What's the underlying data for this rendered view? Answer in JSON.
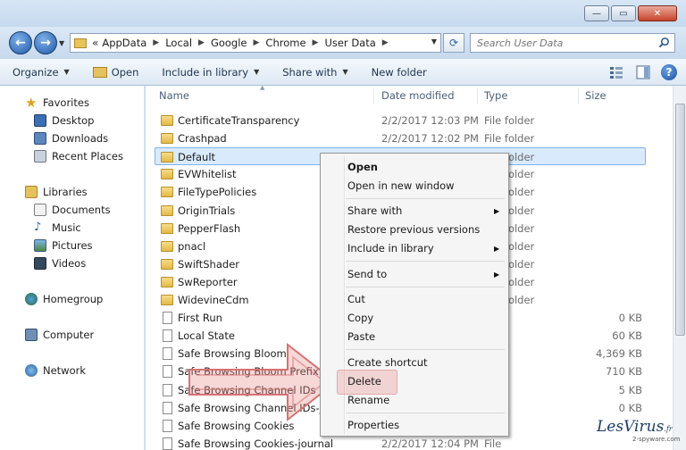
{
  "window": {
    "minimize_glyph": "—",
    "maximize_glyph": "▭",
    "close_glyph": "✕"
  },
  "address": {
    "overflow": "«",
    "crumbs": [
      "AppData",
      "Local",
      "Google",
      "Chrome",
      "User Data"
    ]
  },
  "search": {
    "placeholder": "Search User Data"
  },
  "toolbar": {
    "organize": "Organize",
    "open": "Open",
    "include_in_library": "Include in library",
    "share_with": "Share with",
    "new_folder": "New folder"
  },
  "nav_pane": {
    "favorites": "Favorites",
    "desktop": "Desktop",
    "downloads": "Downloads",
    "recent_places": "Recent Places",
    "libraries": "Libraries",
    "documents": "Documents",
    "music": "Music",
    "pictures": "Pictures",
    "videos": "Videos",
    "homegroup": "Homegroup",
    "computer": "Computer",
    "network": "Network"
  },
  "columns": {
    "name": "Name",
    "date_modified": "Date modified",
    "type": "Type",
    "size": "Size"
  },
  "files": [
    {
      "name": "CertificateTransparency",
      "date": "2/2/2017 12:03 PM",
      "type": "File folder",
      "size": "",
      "kind": "folder"
    },
    {
      "name": "Crashpad",
      "date": "2/2/2017 12:02 PM",
      "type": "File folder",
      "size": "",
      "kind": "folder"
    },
    {
      "name": "Default",
      "date": "",
      "type": "File folder",
      "size": "",
      "kind": "folder",
      "selected": true
    },
    {
      "name": "EVWhitelist",
      "date": "",
      "type": "File folder",
      "size": "",
      "kind": "folder"
    },
    {
      "name": "FileTypePolicies",
      "date": "",
      "type": "File folder",
      "size": "",
      "kind": "folder"
    },
    {
      "name": "OriginTrials",
      "date": "",
      "type": "File folder",
      "size": "",
      "kind": "folder"
    },
    {
      "name": "PepperFlash",
      "date": "",
      "type": "File folder",
      "size": "",
      "kind": "folder"
    },
    {
      "name": "pnacl",
      "date": "",
      "type": "File folder",
      "size": "",
      "kind": "folder"
    },
    {
      "name": "SwiftShader",
      "date": "",
      "type": "File folder",
      "size": "",
      "kind": "folder"
    },
    {
      "name": "SwReporter",
      "date": "",
      "type": "File folder",
      "size": "",
      "kind": "folder"
    },
    {
      "name": "WidevineCdm",
      "date": "",
      "type": "File folder",
      "size": "",
      "kind": "folder"
    },
    {
      "name": "First Run",
      "date": "",
      "type": "",
      "size": "0 KB",
      "kind": "file"
    },
    {
      "name": "Local State",
      "date": "",
      "type": "",
      "size": "60 KB",
      "kind": "file"
    },
    {
      "name": "Safe Browsing Bloom",
      "date": "",
      "type": "",
      "size": "4,369 KB",
      "kind": "file"
    },
    {
      "name": "Safe Browsing Bloom Prefix Set",
      "date": "",
      "type": "",
      "size": "710 KB",
      "kind": "file"
    },
    {
      "name": "Safe Browsing Channel IDs",
      "date": "",
      "type": "",
      "size": "5 KB",
      "kind": "file"
    },
    {
      "name": "Safe Browsing Channel IDs-journal",
      "date": "",
      "type": "",
      "size": "0 KB",
      "kind": "file"
    },
    {
      "name": "Safe Browsing Cookies",
      "date": "",
      "type": "",
      "size": "",
      "kind": "file"
    },
    {
      "name": "Safe Browsing Cookies-journal",
      "date": "2/2/2017 12:04 PM",
      "type": "File",
      "size": "",
      "kind": "file"
    }
  ],
  "context_menu": {
    "open": "Open",
    "open_new_window": "Open in new window",
    "share_with": "Share with",
    "restore_previous": "Restore previous versions",
    "include_in_library": "Include in library",
    "send_to": "Send to",
    "cut": "Cut",
    "copy": "Copy",
    "paste": "Paste",
    "create_shortcut": "Create shortcut",
    "delete": "Delete",
    "rename": "Rename",
    "properties": "Properties"
  },
  "watermark": {
    "brand": "LesVirus",
    "tld": ".fr",
    "sub": "2-spyware.com"
  },
  "colors": {
    "selection_bg": "#d9eafc",
    "selection_border": "#7db4f0",
    "delete_highlight": "#ec9696",
    "arrow": "#e07f7f"
  }
}
